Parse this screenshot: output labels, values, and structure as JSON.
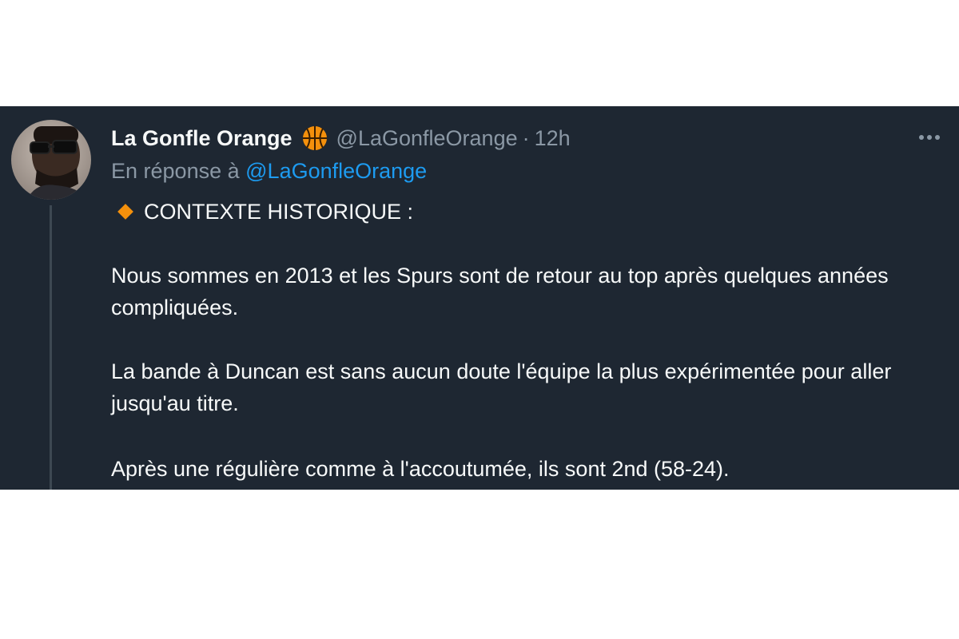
{
  "tweet": {
    "author": {
      "display_name": "La Gonfle Orange",
      "badge_icon": "basketball-icon",
      "handle": "@LaGonfleOrange",
      "separator": "·",
      "timestamp": "12h"
    },
    "reply": {
      "prefix": "En réponse à",
      "mention": "@LaGonfleOrange"
    },
    "heading": {
      "icon": "orange-diamond-icon",
      "text": "CONTEXTE HISTORIQUE :"
    },
    "paragraphs": [
      "Nous sommes en 2013 et les Spurs sont de retour au top après quelques années compliquées.",
      "La bande à Duncan est sans aucun doute l'équipe la plus expérimentée pour aller jusqu'au titre.",
      "Après une régulière comme à l'accoutumée, ils sont 2nd (58-24)."
    ],
    "more_icon": "more-options-icon"
  },
  "colors": {
    "background": "#1e2732",
    "text_primary": "#f7f9f9",
    "text_secondary": "#8b98a5",
    "link": "#1d9bf0",
    "accent_orange": "#f4900c"
  }
}
